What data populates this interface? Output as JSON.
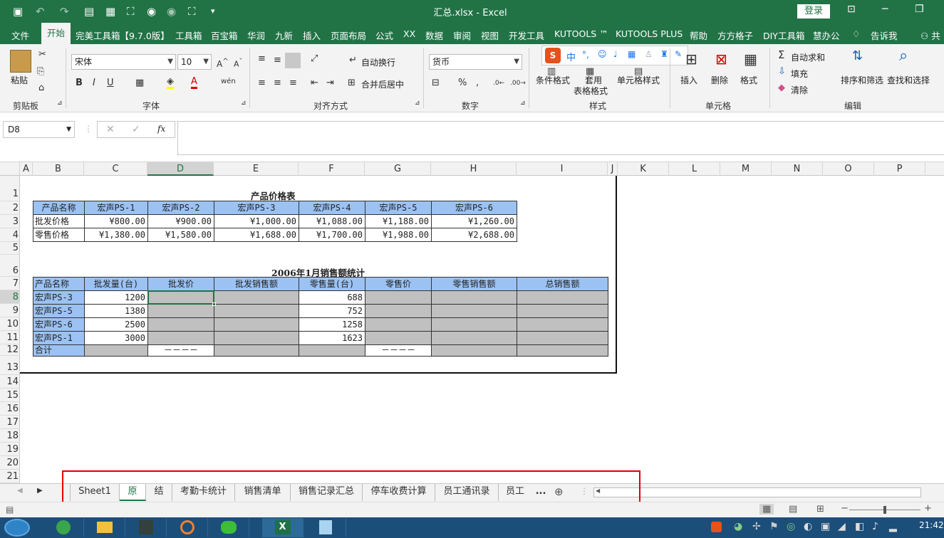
{
  "window": {
    "title": "汇总.xlsx  -  Excel",
    "login": "登录"
  },
  "menu": [
    "文件",
    "开始",
    "完美工具箱【9.7.0版】",
    "工具箱",
    "百宝箱",
    "华润",
    "九新",
    "插入",
    "页面布局",
    "公式",
    "XX",
    "数据",
    "审阅",
    "视图",
    "开发工具",
    "KUTOOLS ™",
    "KUTOOLS PLUS",
    "帮助",
    "方方格子",
    "DIY工具箱",
    "慧办公",
    "告诉我",
    "共"
  ],
  "ribbon": {
    "clipboard": {
      "label": "剪贴板",
      "paste": "粘贴"
    },
    "font": {
      "label": "字体",
      "name": "宋体",
      "size": "10",
      "bold": "B",
      "italic": "I",
      "underline": "U"
    },
    "align": {
      "label": "对齐方式",
      "wrap": "自动换行",
      "merge": "合并后居中"
    },
    "number": {
      "label": "数字",
      "format": "货币",
      "percent": "%"
    },
    "styles": {
      "label": "样式",
      "cond": "条件格式",
      "table1": "套用",
      "table2": "表格格式",
      "cell": "单元格样式"
    },
    "cells": {
      "label": "单元格",
      "insert": "插入",
      "delete": "删除",
      "format": "格式"
    },
    "editing": {
      "label": "编辑",
      "autosum": "自动求和",
      "fill": "填充",
      "clear": "清除",
      "sort": "排序和筛选",
      "find": "查找和选择"
    },
    "ime": "中"
  },
  "formula": {
    "namebox": "D8",
    "fx": "fx",
    "value": ""
  },
  "columns": [
    "A",
    "B",
    "C",
    "D",
    "E",
    "F",
    "G",
    "H",
    "I",
    "J",
    "K",
    "L",
    "M",
    "N",
    "O",
    "P"
  ],
  "rows": [
    "1",
    "2",
    "3",
    "4",
    "5",
    "6",
    "7",
    "8",
    "9",
    "10",
    "11",
    "12",
    "13",
    "14",
    "15",
    "16",
    "17",
    "18",
    "19",
    "20",
    "21"
  ],
  "table1": {
    "title": "产品价格表",
    "headers": [
      "产品名称",
      "宏声PS-1",
      "宏声PS-2",
      "宏声PS-3",
      "宏声PS-4",
      "宏声PS-5",
      "宏声PS-6"
    ],
    "rows": [
      [
        "批发价格",
        "¥800.00",
        "¥900.00",
        "¥1,000.00",
        "¥1,088.00",
        "¥1,188.00",
        "¥1,260.00"
      ],
      [
        "零售价格",
        "¥1,380.00",
        "¥1,580.00",
        "¥1,688.00",
        "¥1,700.00",
        "¥1,988.00",
        "¥2,688.00"
      ]
    ]
  },
  "table2": {
    "title": "2006年1月销售额统计",
    "headers": [
      "产品名称",
      "批发量(台)",
      "批发价",
      "批发销售额",
      "零售量(台)",
      "零售价",
      "零售销售额",
      "总销售额"
    ],
    "rows": [
      [
        "宏声PS-3",
        "1200",
        "",
        "",
        "688",
        "",
        "",
        ""
      ],
      [
        "宏声PS-5",
        "1380",
        "",
        "",
        "752",
        "",
        "",
        ""
      ],
      [
        "宏声PS-6",
        "2500",
        "",
        "",
        "1258",
        "",
        "",
        ""
      ],
      [
        "宏声PS-1",
        "3000",
        "",
        "",
        "1623",
        "",
        "",
        ""
      ],
      [
        "合计",
        "",
        "－－－－",
        "",
        "",
        "－－－－",
        "",
        ""
      ]
    ]
  },
  "tabs": [
    "Sheet1",
    "原",
    "结",
    "考勤卡统计",
    "销售清单",
    "销售记录汇总",
    "停车收费计算",
    "员工通讯录",
    "员工通",
    "..."
  ],
  "active_tab": "原",
  "status": {
    "zoom_plus": "+"
  },
  "clock": {
    "time": "21:42"
  }
}
